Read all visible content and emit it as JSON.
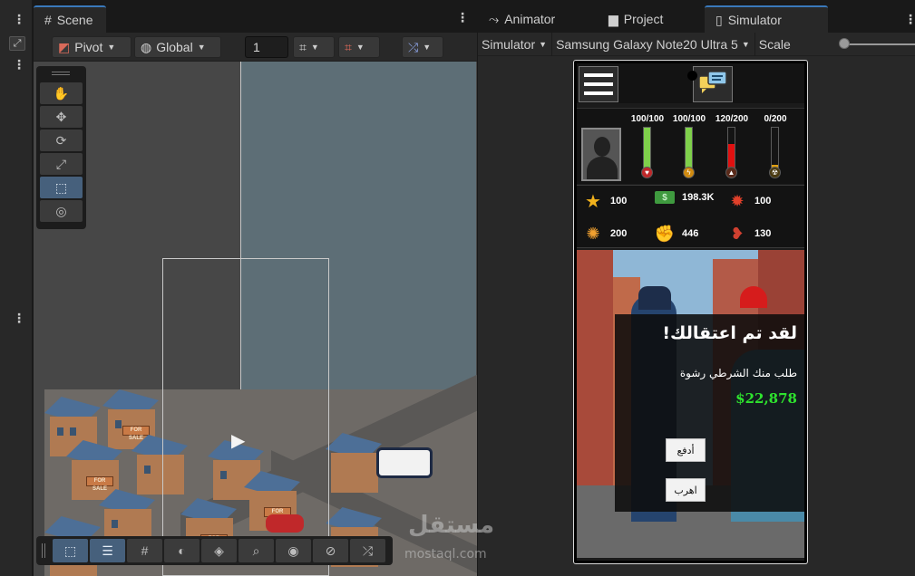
{
  "scene_tab": {
    "label": "Scene"
  },
  "scene_toolbar": {
    "pivot_label": "Pivot",
    "global_label": "Global",
    "grid_value": "1"
  },
  "right_tabs": [
    {
      "label": "Animator"
    },
    {
      "label": "Project"
    },
    {
      "label": "Simulator"
    }
  ],
  "simulator_bar": {
    "mode_label": "Simulator",
    "device_label": "Samsung Galaxy Note20 Ultra 5",
    "scale_label": "Scale"
  },
  "game": {
    "meters": [
      {
        "label": "100/100",
        "fill": 1.0,
        "color": "#7fd04b",
        "icon": "heart-icon"
      },
      {
        "label": "100/100",
        "fill": 1.0,
        "color": "#7fd04b",
        "icon": "lightning-icon"
      },
      {
        "label": "120/200",
        "fill": 0.6,
        "color": "#e01010",
        "icon": "fire-icon"
      },
      {
        "label": "0/200",
        "fill": 0.0,
        "color": "#e0a010",
        "icon": "hazard-icon"
      }
    ],
    "resources": [
      {
        "icon": "star-icon",
        "value": "100"
      },
      {
        "icon": "cash-icon",
        "value": "198.3K"
      },
      {
        "icon": "flame-icon",
        "value": "100"
      },
      {
        "icon": "brain-icon",
        "value": "200"
      },
      {
        "icon": "muscle-icon",
        "value": "446"
      },
      {
        "icon": "heart-hand-icon",
        "value": "130"
      }
    ],
    "event": {
      "title": "لقد تم اعتقالك!",
      "description": "طلب منك الشرطي رشوة",
      "amount": "$22,878",
      "pay_label": "أدفع",
      "flee_label": "اهرب"
    }
  },
  "watermark": {
    "arabic": "مستقل",
    "latin": "mostaql.com"
  }
}
